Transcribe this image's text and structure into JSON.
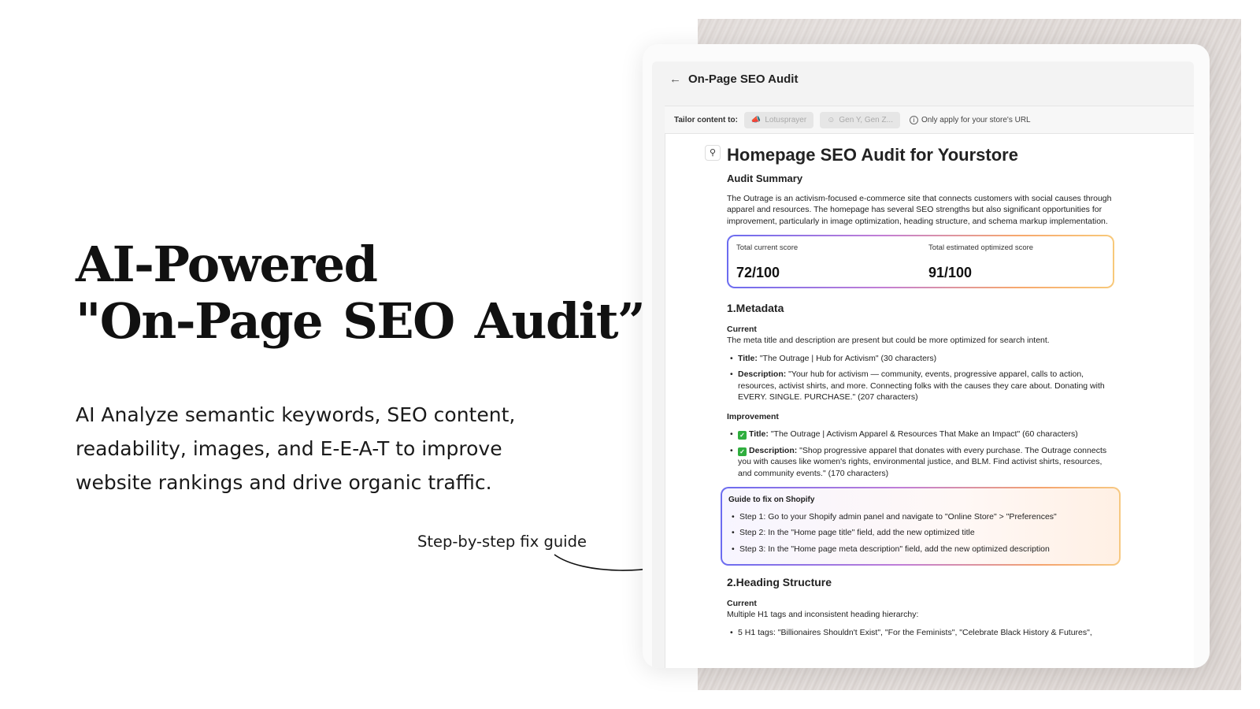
{
  "hero": {
    "title_line1": "AI-Powered",
    "title_line2_prefix": "\"On-Page ",
    "title_line2_highlight": "SEO",
    "title_line2_suffix": " Audit”",
    "subtitle": "AI Analyze semantic keywords, SEO content, readability, images, and E-E-A-T to improve website rankings and drive organic traffic.",
    "callout": "Step-by-step fix guide",
    "highlight_color": "#f4a37a"
  },
  "app": {
    "back_icon": "arrow-left-icon",
    "title": "On-Page SEO Audit",
    "toolbar": {
      "label": "Tailor content to:",
      "chip1": "Lotusprayer",
      "chip1_icon": "megaphone-icon",
      "chip2": "Gen Y, Gen Z...",
      "chip2_icon": "person-icon",
      "note": "Only apply for your store's URL",
      "note_icon": "info-icon"
    },
    "doc": {
      "title": "Homepage SEO Audit for Yourstore",
      "summary_heading": "Audit Summary",
      "summary_text": "The Outrage is an activism-focused e-commerce site that connects customers with social causes through apparel and resources. The homepage has several SEO strengths but also significant opportunities for improvement, particularly in image optimization, heading structure, and schema markup implementation.",
      "score": {
        "current_label": "Total current score",
        "current_value": "72/100",
        "optimized_label": "Total estimated optimized score",
        "optimized_value": "91/100"
      },
      "metadata_heading": "1.Metadata",
      "current_label": "Current",
      "current_text": "The meta title and description are present but could be more optimized for search intent.",
      "current_items": [
        {
          "label": "Title:",
          "text": " \"The Outrage | Hub for Activism\" (30 characters)"
        },
        {
          "label": "Description:",
          "text": " \"Your hub for activism — community, events, progressive apparel, calls to action, resources, activist shirts, and more. Connecting folks with the causes they care about. Donating with EVERY. SINGLE. PURCHASE.\" (207 characters)"
        }
      ],
      "improvement_label": "Improvement",
      "improvement_items": [
        {
          "label": "Title:",
          "text": " \"The Outrage | Activism Apparel & Resources That Make an Impact\" (60 characters)"
        },
        {
          "label": "Description:",
          "text": " \"Shop progressive apparel that donates with every purchase. The Outrage connects you with causes like women's rights, environmental justice, and BLM. Find activist shirts, resources, and community events.\" (170 characters)"
        }
      ],
      "guide": {
        "title": "Guide to fix on Shopify",
        "steps": [
          "Step 1: Go to your Shopify admin panel and navigate to \"Online Store\" > \"Preferences\"",
          "Step 2: In the \"Home page title\" field, add the new optimized title",
          "Step 3: In the \"Home page meta description\" field, add the new optimized description"
        ]
      },
      "heading_structure": "2.Heading Structure",
      "hs_current_label": "Current",
      "hs_current_text": "Multiple H1 tags and inconsistent heading hierarchy:",
      "hs_items": [
        "5 H1 tags: \"Billionaires Shouldn't Exist\", \"For the Feminists\", \"Celebrate Black History & Futures\","
      ]
    }
  }
}
